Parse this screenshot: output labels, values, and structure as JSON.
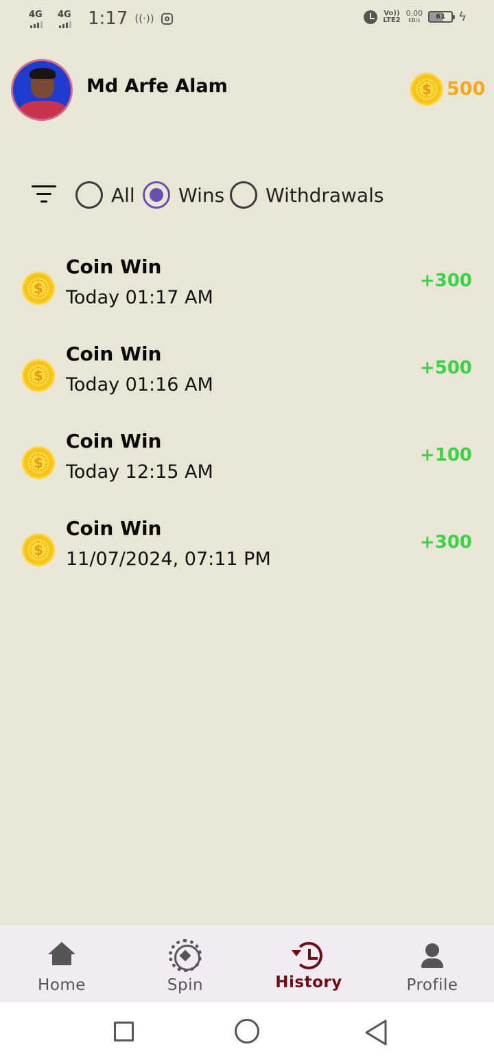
{
  "status_bar": {
    "net1": "4G",
    "net2": "4G",
    "time": "1:17",
    "volte_top": "Vo))",
    "volte_bottom": "LTE2",
    "speed_value": "0.00",
    "speed_unit": "KB/s",
    "battery": "61",
    "icons": [
      "hotspot-icon",
      "instagram-icon",
      "alarm-icon",
      "charging-icon"
    ]
  },
  "header": {
    "user_name": "Md Arfe Alam",
    "coin_balance": "500"
  },
  "filter": {
    "options": [
      {
        "label": "All",
        "checked": false
      },
      {
        "label": "Wins",
        "checked": true
      },
      {
        "label": "Withdrawals",
        "checked": false
      }
    ]
  },
  "history": [
    {
      "title": "Coin Win",
      "time": "Today 01:17 AM",
      "amount": "+300"
    },
    {
      "title": "Coin Win",
      "time": "Today 01:16 AM",
      "amount": "+500"
    },
    {
      "title": "Coin Win",
      "time": "Today 12:15 AM",
      "amount": "+100"
    },
    {
      "title": "Coin Win",
      "time": "11/07/2024, 07:11 PM",
      "amount": "+300"
    }
  ],
  "bottom_nav": {
    "items": [
      {
        "label": "Home",
        "icon": "home-icon"
      },
      {
        "label": "Spin",
        "icon": "spin-wheel-icon"
      },
      {
        "label": "History",
        "icon": "history-icon",
        "active": true
      },
      {
        "label": "Profile",
        "icon": "person-icon"
      }
    ]
  },
  "colors": {
    "background": "#e9e6d5",
    "accent_radio": "#6a4fb0",
    "amount_green": "#3dd148",
    "coin_gold": "#f2a91d",
    "nav_active": "#6b0f12"
  }
}
